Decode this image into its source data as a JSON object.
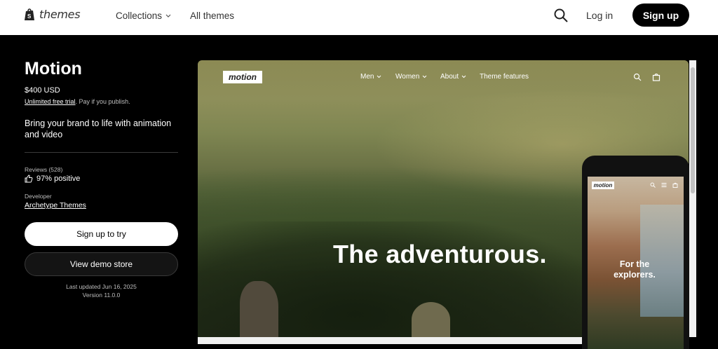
{
  "header": {
    "logo_text": "themes",
    "nav": [
      {
        "label": "Collections"
      },
      {
        "label": "All themes"
      }
    ],
    "login_label": "Log in",
    "signup_label": "Sign up"
  },
  "theme": {
    "name": "Motion",
    "price": "$400 USD",
    "trial_link": "Unlimited free trial",
    "trial_suffix": ". Pay if you publish.",
    "description": "Bring your brand to life with animation and video",
    "reviews_label": "Reviews (528)",
    "positive": "97% positive",
    "developer_label": "Developer",
    "developer_name": "Archetype Themes",
    "try_button": "Sign up to try",
    "demo_button": "View demo store",
    "last_updated": "Last updated Jun 16, 2025",
    "version": "Version 11.0.0"
  },
  "preview": {
    "logo": "motion",
    "nav": [
      {
        "label": "Men"
      },
      {
        "label": "Women"
      },
      {
        "label": "About"
      },
      {
        "label": "Theme features"
      }
    ],
    "headline": "The adventurous.",
    "phone_logo": "motion",
    "phone_headline": "For the explorers."
  },
  "icons": [
    "shopify-bag-icon",
    "search-icon",
    "chevron-down-icon",
    "thumbs-up-icon",
    "cart-icon",
    "menu-icon"
  ]
}
